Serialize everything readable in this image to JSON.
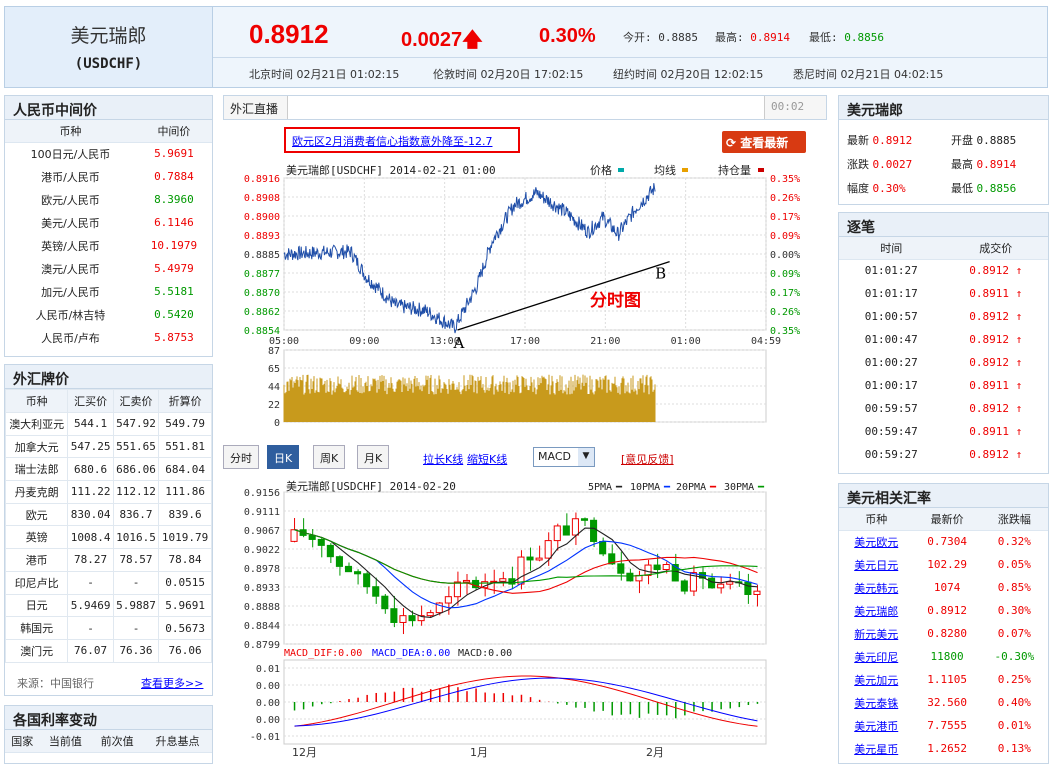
{
  "header": {
    "title": "美元瑞郎",
    "code": "(USDCHF)",
    "price": "0.8912",
    "change": "0.0027",
    "pct": "0.30%",
    "open_label": "今开:",
    "open": "0.8885",
    "high_label": "最高:",
    "high": "0.8914",
    "low_label": "最低:",
    "low": "0.8856",
    "times": [
      "北京时间  02月21日  01:02:15",
      "伦敦时间  02月20日  17:02:15",
      "纽约时间  02月20日  12:02:15",
      "悉尼时间  02月21日  04:02:15"
    ]
  },
  "rmb": {
    "title": "人民币中间价",
    "col1": "币种",
    "col2": "中间价",
    "rows": [
      [
        "100日元/人民币",
        "5.9691",
        "red"
      ],
      [
        "港币/人民币",
        "0.7884",
        "red"
      ],
      [
        "欧元/人民币",
        "8.3960",
        "green"
      ],
      [
        "美元/人民币",
        "6.1146",
        "red"
      ],
      [
        "英镑/人民币",
        "10.1979",
        "red"
      ],
      [
        "澳元/人民币",
        "5.4979",
        "red"
      ],
      [
        "加元/人民币",
        "5.5181",
        "green"
      ],
      [
        "人民币/林吉特",
        "0.5420",
        "green"
      ],
      [
        "人民币/卢布",
        "5.8753",
        "red"
      ]
    ]
  },
  "fx": {
    "title": "外汇牌价",
    "cols": [
      "币种",
      "汇买价",
      "汇卖价",
      "折算价"
    ],
    "rows": [
      [
        "澳大利亚元",
        "544.1",
        "547.92",
        "549.79"
      ],
      [
        "加拿大元",
        "547.25",
        "551.65",
        "551.81"
      ],
      [
        "瑞士法郎",
        "680.6",
        "686.06",
        "684.04"
      ],
      [
        "丹麦克朗",
        "111.22",
        "112.12",
        "111.86"
      ],
      [
        "欧元",
        "830.04",
        "836.7",
        "839.6"
      ],
      [
        "英镑",
        "1008.4",
        "1016.5",
        "1019.79"
      ],
      [
        "港币",
        "78.27",
        "78.57",
        "78.84"
      ],
      [
        "印尼卢比",
        "-",
        "-",
        "0.0515"
      ],
      [
        "日元",
        "5.9469",
        "5.9887",
        "5.9691"
      ],
      [
        "韩国元",
        "-",
        "-",
        "0.5673"
      ],
      [
        "澳门元",
        "76.07",
        "76.36",
        "76.06"
      ]
    ],
    "source": "来源：中国银行",
    "more": "查看更多>>"
  },
  "rate": {
    "title": "各国利率变动",
    "cols": [
      "国家",
      "当前值",
      "前次值",
      "升息基点"
    ]
  },
  "live": {
    "tab": "外汇直播",
    "time": "00:02",
    "news": "欧元区2月消费者信心指数意外降至-12.7",
    "refresh": "查看最新"
  },
  "intraday": {
    "title": "美元瑞郎[USDCHF] 2014-02-21 01:00",
    "legend": [
      "价格",
      "均线",
      "持仓量"
    ],
    "left_ticks": [
      "0.8916",
      "0.8908",
      "0.8900",
      "0.8893",
      "0.8885",
      "0.8877",
      "0.8870",
      "0.8862",
      "0.8854"
    ],
    "right_ticks": [
      "0.35%",
      "0.26%",
      "0.17%",
      "0.09%",
      "0.00%",
      "0.09%",
      "0.17%",
      "0.26%",
      "0.35%"
    ],
    "x_ticks": [
      "05:00",
      "09:00",
      "13:00",
      "17:00",
      "21:00",
      "01:00",
      "04:59"
    ],
    "vol_ticks": [
      "87",
      "65",
      "44",
      "22",
      "0"
    ],
    "label_a": "A",
    "label_b": "B",
    "caption": "分时图"
  },
  "tabs": {
    "items": [
      "分时",
      "日K",
      "周K",
      "月K"
    ],
    "links": [
      "拉长K线",
      "缩短K线"
    ],
    "select": "MACD",
    "feedback": "[意见反馈]"
  },
  "kline": {
    "title": "美元瑞郎[USDCHF] 2014-02-20",
    "legend": [
      "5PMA",
      "10PMA",
      "20PMA",
      "30PMA"
    ],
    "ticks": [
      "0.9156",
      "0.9111",
      "0.9067",
      "0.9022",
      "0.8978",
      "0.8933",
      "0.8888",
      "0.8844",
      "0.8799"
    ],
    "macd_label": [
      "MACD_DIF:0.00",
      "MACD_DEA:0.00",
      "MACD:0.00"
    ],
    "macd_ticks": [
      "0.01",
      "0.00",
      "0.00",
      "0.00",
      "-0.01"
    ],
    "months": [
      "12月",
      "1月",
      "2月"
    ]
  },
  "quote": {
    "title": "美元瑞郎",
    "latest_l": "最新",
    "latest": "0.8912",
    "open_l": "开盘",
    "open": "0.8885",
    "chg_l": "涨跌",
    "chg": "0.0027",
    "high_l": "最高",
    "high": "0.8914",
    "pct_l": "幅度",
    "pct": "0.30%",
    "low_l": "最低",
    "low": "0.8856"
  },
  "ticks_panel": {
    "title": "逐笔",
    "cols": [
      "时间",
      "成交价"
    ],
    "rows": [
      [
        "01:01:27",
        "0.8912"
      ],
      [
        "01:01:17",
        "0.8911"
      ],
      [
        "01:00:57",
        "0.8912"
      ],
      [
        "01:00:47",
        "0.8912"
      ],
      [
        "01:00:27",
        "0.8912"
      ],
      [
        "01:00:17",
        "0.8911"
      ],
      [
        "00:59:57",
        "0.8912"
      ],
      [
        "00:59:47",
        "0.8911"
      ],
      [
        "00:59:27",
        "0.8912"
      ]
    ]
  },
  "related": {
    "title": "美元相关汇率",
    "cols": [
      "币种",
      "最新价",
      "涨跌幅"
    ],
    "rows": [
      [
        "美元欧元",
        "0.7304",
        "0.32%",
        "red"
      ],
      [
        "美元日元",
        "102.29",
        "0.05%",
        "red"
      ],
      [
        "美元韩元",
        "1074",
        "0.85%",
        "red"
      ],
      [
        "美元瑞郎",
        "0.8912",
        "0.30%",
        "red"
      ],
      [
        "新元美元",
        "0.8280",
        "0.07%",
        "red"
      ],
      [
        "美元印尼",
        "11800",
        "-0.30%",
        "green"
      ],
      [
        "美元加元",
        "1.1105",
        "0.25%",
        "red"
      ],
      [
        "美元泰铢",
        "32.560",
        "0.40%",
        "red"
      ],
      [
        "美元港币",
        "7.7555",
        "0.01%",
        "red"
      ],
      [
        "美元星币",
        "1.2652",
        "0.13%",
        "red"
      ]
    ]
  },
  "colors": {
    "up": "#e00",
    "down": "#090",
    "line": "#1f4ea8",
    "volume": "#c89a1c"
  }
}
